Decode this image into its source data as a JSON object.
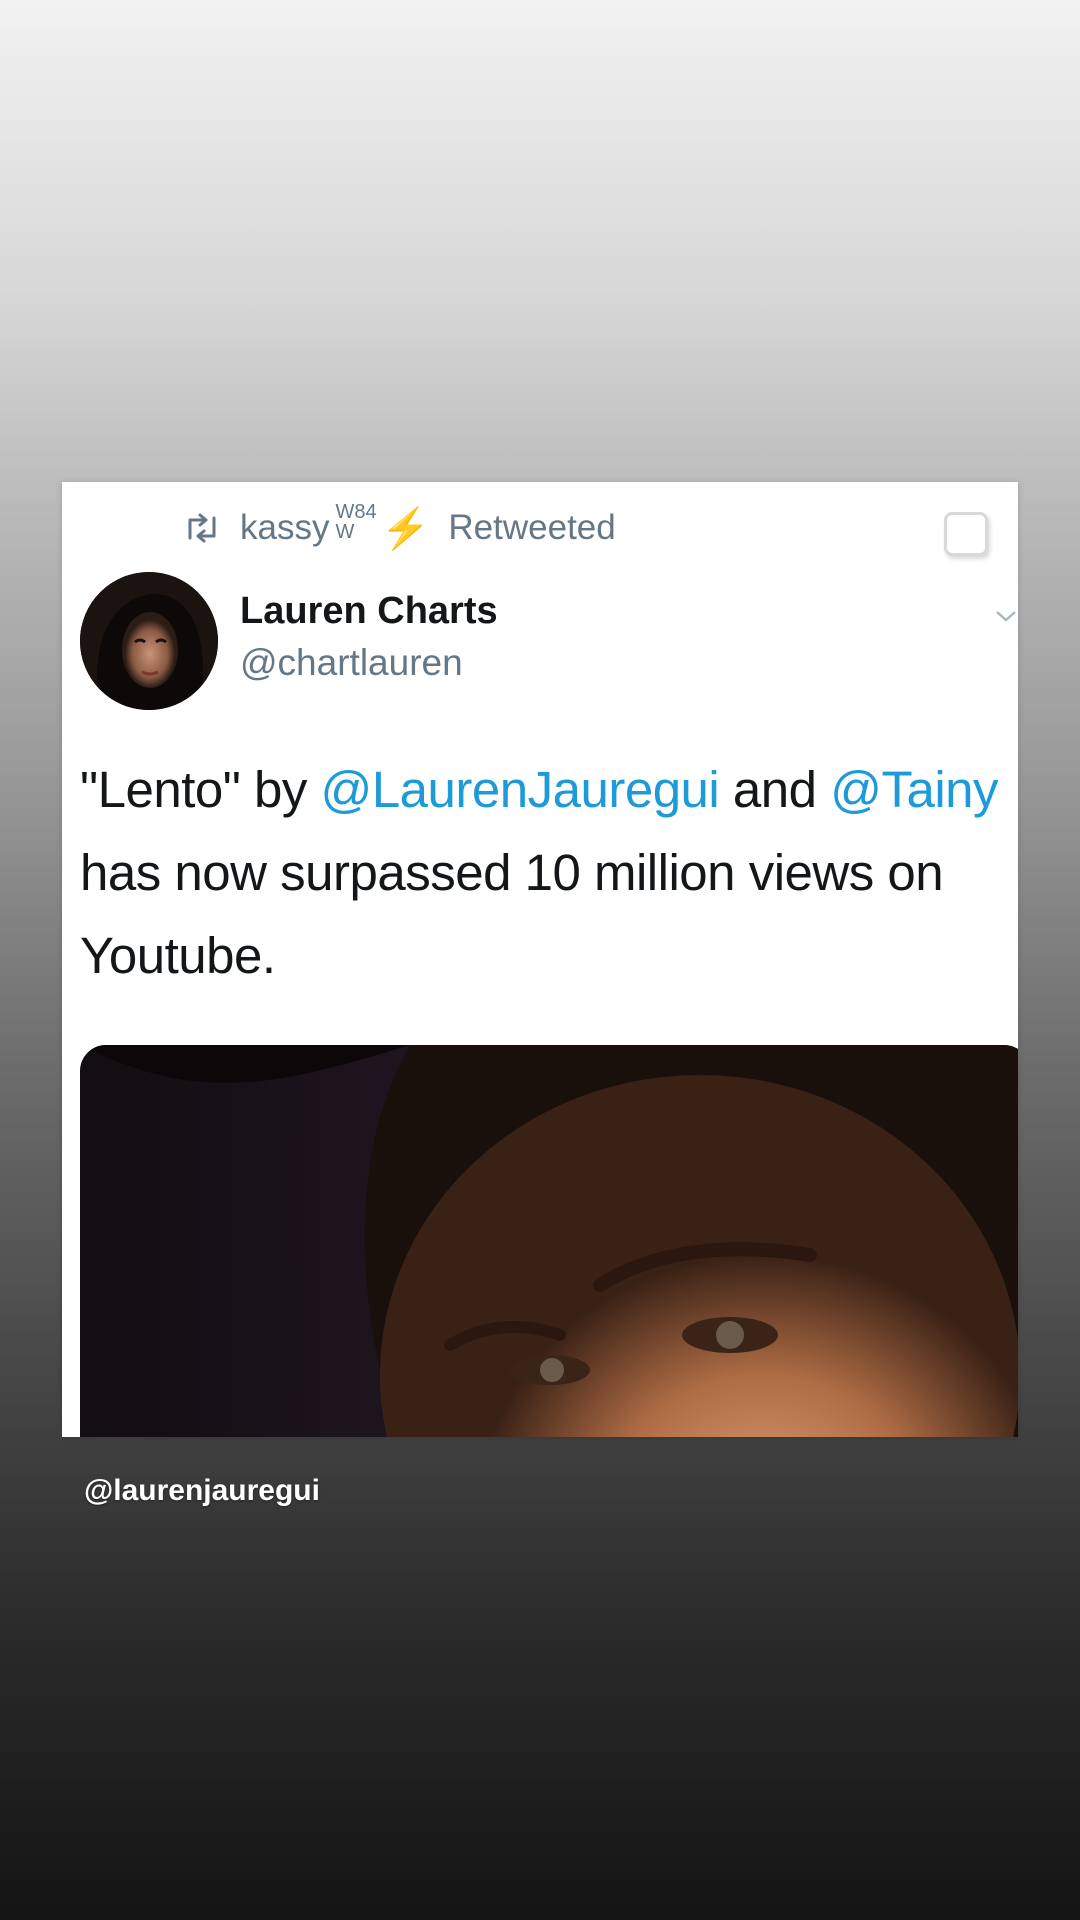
{
  "retweet": {
    "icon": "retweet-icon",
    "user": "kassy",
    "badge_top": "W84",
    "badge_bottom": "W",
    "bolt": "⚡",
    "label": "Retweeted"
  },
  "tweet": {
    "display_name": "Lauren Charts",
    "handle": "@chartlauren",
    "text": {
      "part1": "\"Lento\" by ",
      "mention1": "@LaurenJauregui",
      "part2": " and ",
      "mention2": "@Tainy",
      "part3": " has now surpassed 10 million views on Youtube."
    }
  },
  "story": {
    "caption": "@laurenjauregui"
  },
  "colors": {
    "mention": "#1d9bd8",
    "secondary_text": "#657786",
    "primary_text": "#14171a",
    "bolt": "#f5c518"
  }
}
